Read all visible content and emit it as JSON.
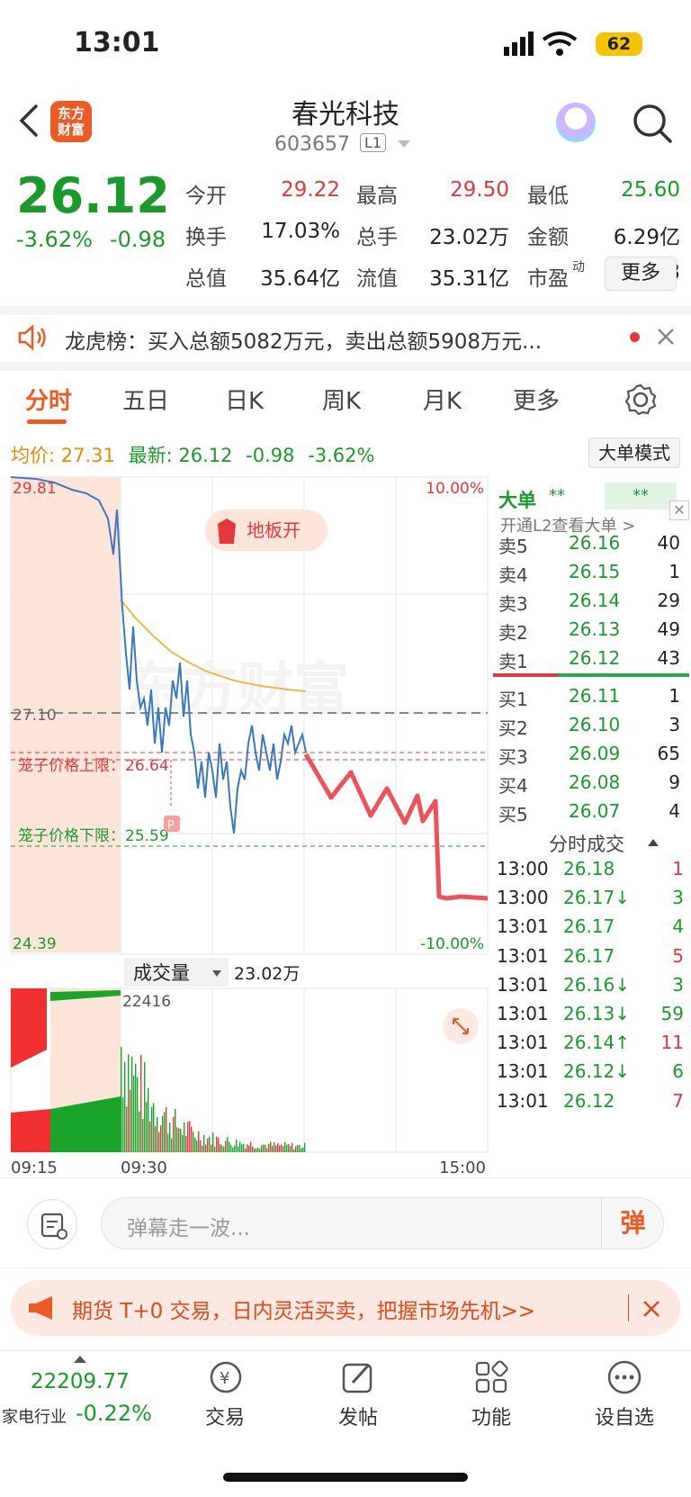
{
  "status_bar": {
    "time": "13:01",
    "battery": "62"
  },
  "header": {
    "logo": "东方\n财富",
    "title": "春光科技",
    "code": "603657",
    "level": "L1"
  },
  "quote": {
    "price": "26.12",
    "change_pct": "-3.62%",
    "change_abs": "-0.98",
    "rows": [
      [
        [
          "今开",
          "29.22",
          "red"
        ],
        [
          "最高",
          "29.50",
          "red"
        ],
        [
          "最低",
          "25.60",
          "green"
        ]
      ],
      [
        [
          "换手",
          "17.03%",
          "dark"
        ],
        [
          "总手",
          "23.02万",
          "dark"
        ],
        [
          "金额",
          "6.29亿",
          "dark"
        ]
      ],
      [
        [
          "总值",
          "35.64亿",
          "dark"
        ],
        [
          "流值",
          "35.31亿",
          "dark"
        ],
        [
          "市盈",
          "306.03",
          "dark"
        ]
      ]
    ],
    "pe_sup": "动",
    "more": "更多"
  },
  "longhubang": "龙虎榜：买入总额5082万元，卖出总额5908万元...",
  "tabs": [
    "分时",
    "五日",
    "日K",
    "周K",
    "月K",
    "更多"
  ],
  "info_line": {
    "avg_label": "均价:",
    "avg": "27.31",
    "latest_label": "最新:",
    "latest": "26.12",
    "chg": "-0.98",
    "pct": "-3.62%"
  },
  "big_order_mode": "大单模式",
  "chart": {
    "y_top": "29.81",
    "y_bottom": "24.39",
    "y_ref": "27.10",
    "pct_top": "10.00%",
    "pct_bottom": "-10.00%",
    "badge": "地板开",
    "cage_upper": "笼子价格上限：26.64",
    "cage_lower": "笼子价格下限：25.59",
    "volume_label": "成交量",
    "volume_total": "23.02万",
    "volume_max": "22416",
    "x_labels": [
      "09:15",
      "09:30",
      "15:00"
    ],
    "watermark": "东方财富"
  },
  "order_book": {
    "big_label": "大单",
    "big_a": "**",
    "big_b": "**",
    "l2_tip": "开通L2查看大单 >",
    "asks": [
      [
        "卖5",
        "26.16",
        "40"
      ],
      [
        "卖4",
        "26.15",
        "1"
      ],
      [
        "卖3",
        "26.14",
        "29"
      ],
      [
        "卖2",
        "26.13",
        "49"
      ],
      [
        "卖1",
        "26.12",
        "43"
      ]
    ],
    "bids": [
      [
        "买1",
        "26.11",
        "1"
      ],
      [
        "买2",
        "26.10",
        "3"
      ],
      [
        "买3",
        "26.09",
        "65"
      ],
      [
        "买4",
        "26.08",
        "9"
      ],
      [
        "买5",
        "26.07",
        "4"
      ]
    ],
    "trades_title": "分时成交",
    "trades": [
      [
        "13:00",
        "26.18",
        "1",
        "red"
      ],
      [
        "13:00",
        "26.17↓",
        "3",
        "green"
      ],
      [
        "13:01",
        "26.17",
        "4",
        "green"
      ],
      [
        "13:01",
        "26.17",
        "5",
        "red"
      ],
      [
        "13:01",
        "26.16↓",
        "3",
        "green"
      ],
      [
        "13:01",
        "26.13↓",
        "59",
        "green"
      ],
      [
        "13:01",
        "26.14↑",
        "11",
        "red"
      ],
      [
        "13:01",
        "26.12↓",
        "6",
        "green"
      ],
      [
        "13:01",
        "26.12",
        "7",
        "red"
      ]
    ]
  },
  "danmaku": {
    "placeholder": "弹幕走一波...",
    "send": "弹"
  },
  "promo": "期货 T+0 交易，日内灵活买卖，把握市场先机>>",
  "bottom_nav": {
    "index_value": "22209.77",
    "index_name": "家电行业",
    "index_change": "-0.22%",
    "items": [
      "交易",
      "发帖",
      "功能",
      "设自选"
    ]
  },
  "colors": {
    "up": "#e4393c",
    "down": "#1a9a2a",
    "accent": "#ee5a24",
    "avg_line": "#e8b84a",
    "price_line": "#3a78c0"
  }
}
